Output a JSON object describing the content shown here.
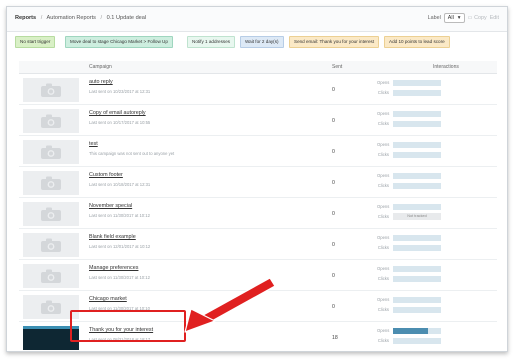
{
  "breadcrumbs": {
    "root": "Reports",
    "middle": "Automation Reports",
    "current": "0.1 Update deal",
    "separator": "/"
  },
  "topbar": {
    "label_text": "Label",
    "label_select_value": "All",
    "copy": "Copy",
    "edit": "Edit"
  },
  "steps": [
    {
      "label": "No start trigger",
      "bg": "#d9f0c6",
      "border": "#b7dca0"
    },
    {
      "label": "Move deal to stage Chicago Market > Follow Up",
      "bg": "#cdeedf",
      "border": "#9fd6bf"
    },
    {
      "label": "Notify 1 addresses",
      "bg": "#e8f7ef",
      "border": "#bfe3cf"
    },
    {
      "label": "Wait for 2 day(s)",
      "bg": "#dde9f6",
      "border": "#b7cde6"
    },
    {
      "label": "Send email: Thank you for your interest",
      "bg": "#fbe9c6",
      "border": "#ecd093"
    },
    {
      "label": "Add 10 points to lead score",
      "bg": "#fbe9c6",
      "border": "#ecd093"
    }
  ],
  "table": {
    "headers": {
      "campaign": "Campaign",
      "sent": "Sent",
      "interactions": "Interactions"
    },
    "opens_label": "Opens",
    "clicks_label": "Clicks",
    "rows": [
      {
        "name": "auto reply",
        "sub": "Last sent on 10/23/2017 at 12:31",
        "sent": "0",
        "opens": 0,
        "clicks": 0,
        "clicks_note": ""
      },
      {
        "name": "Copy of email autoreply",
        "sub": "Last sent on 10/17/2017 at 10:55",
        "sent": "0",
        "opens": 0,
        "clicks": 0,
        "clicks_note": ""
      },
      {
        "name": "test",
        "sub": "This campaign was not sent out to anyone yet",
        "sent": "0",
        "opens": 0,
        "clicks": 0,
        "clicks_note": ""
      },
      {
        "name": "Custom footer",
        "sub": "Last sent on 10/18/2017 at 12:31",
        "sent": "0",
        "opens": 0,
        "clicks": 0,
        "clicks_note": ""
      },
      {
        "name": "November special",
        "sub": "Last sent on 11/30/2017 at 10:12",
        "sent": "0",
        "opens": 0,
        "clicks": 0,
        "clicks_note": "Not tracked"
      },
      {
        "name": "Blank field example",
        "sub": "Last sent on 12/01/2017 at 10:12",
        "sent": "0",
        "opens": 0,
        "clicks": 0,
        "clicks_note": ""
      },
      {
        "name": "Manage preferences",
        "sub": "Last sent on 11/30/2017 at 10:12",
        "sent": "0",
        "opens": 0,
        "clicks": 0,
        "clicks_note": ""
      },
      {
        "name": "Chicago market",
        "sub": "Last sent on 11/30/2017 at 10:10",
        "sent": "0",
        "opens": 0,
        "clicks": 0,
        "clicks_note": ""
      },
      {
        "name": "Thank you for your interest",
        "sub": "Last sent on 08/31/2018 at 18:17",
        "sent": "18",
        "opens": 0.72,
        "clicks": 0,
        "clicks_note": ""
      }
    ]
  },
  "colors": {
    "highlight": "#e02020",
    "bar_track": "#d8e6ee",
    "bar_fill": "#4b8db0"
  }
}
